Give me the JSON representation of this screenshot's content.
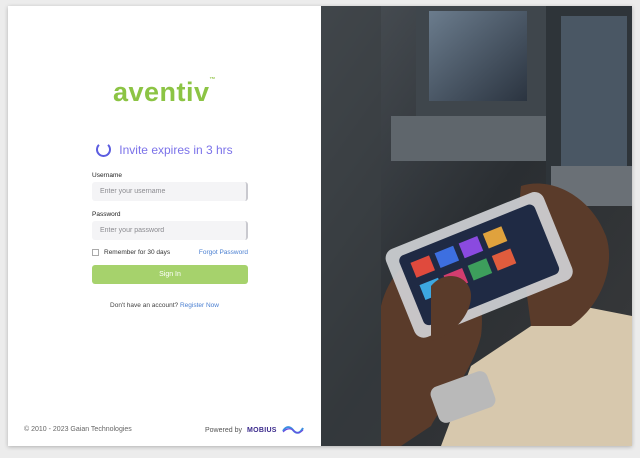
{
  "brand": {
    "name": "aventiv",
    "color": "#8cc444"
  },
  "invite": {
    "text": "Invite expires in 3 hrs",
    "color": "#7b72e9"
  },
  "form": {
    "username_label": "Username",
    "username_placeholder": "Enter your username",
    "password_label": "Password",
    "password_placeholder": "Enter your password",
    "remember_label": "Remember for 30 days",
    "forgot_label": "Forgot Password",
    "signin_label": "Sign In",
    "signin_color": "#a6d26c"
  },
  "register": {
    "prompt": "Don't have an account?",
    "link": "Register Now"
  },
  "footer": {
    "copyright": "2010 - 2023 Gaian Technologies",
    "powered_by": "Powered by",
    "mobius": "MOBIUS"
  }
}
